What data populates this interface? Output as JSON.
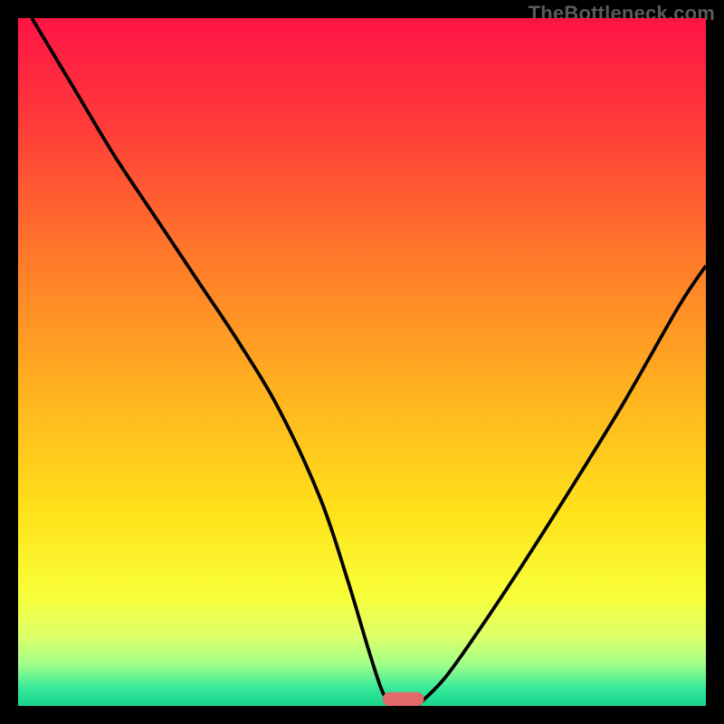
{
  "watermark": "TheBottleneck.com",
  "colors": {
    "background": "#000000",
    "curve": "#000000",
    "marker": "#e26a6a",
    "gradient_stops": [
      {
        "offset": 0.0,
        "color": "#ff1445"
      },
      {
        "offset": 0.15,
        "color": "#ff3a3a"
      },
      {
        "offset": 0.35,
        "color": "#ff7a2a"
      },
      {
        "offset": 0.55,
        "color": "#ffb41f"
      },
      {
        "offset": 0.72,
        "color": "#ffe21a"
      },
      {
        "offset": 0.84,
        "color": "#f8ff3a"
      },
      {
        "offset": 0.9,
        "color": "#dcff6a"
      },
      {
        "offset": 0.94,
        "color": "#9fff8a"
      },
      {
        "offset": 0.975,
        "color": "#36e89a"
      },
      {
        "offset": 1.0,
        "color": "#17d58c"
      }
    ]
  },
  "chart_data": {
    "type": "line",
    "title": "",
    "xlabel": "",
    "ylabel": "",
    "xlim": [
      0,
      100
    ],
    "ylim": [
      0,
      100
    ],
    "series": [
      {
        "name": "left-curve",
        "x": [
          2,
          8,
          14,
          20,
          26,
          32,
          38,
          44,
          48,
          51,
          53,
          54.5
        ],
        "values": [
          100,
          90,
          80,
          71,
          62,
          53,
          43,
          30,
          18,
          8,
          2,
          0
        ]
      },
      {
        "name": "right-curve",
        "x": [
          58,
          62,
          67,
          73,
          80,
          88,
          96,
          100
        ],
        "values": [
          0,
          4,
          11,
          20,
          31,
          44,
          58,
          64
        ]
      }
    ],
    "marker": {
      "name": "bottleneck-marker",
      "x": 56,
      "y": 0,
      "width": 6,
      "height": 2
    }
  }
}
